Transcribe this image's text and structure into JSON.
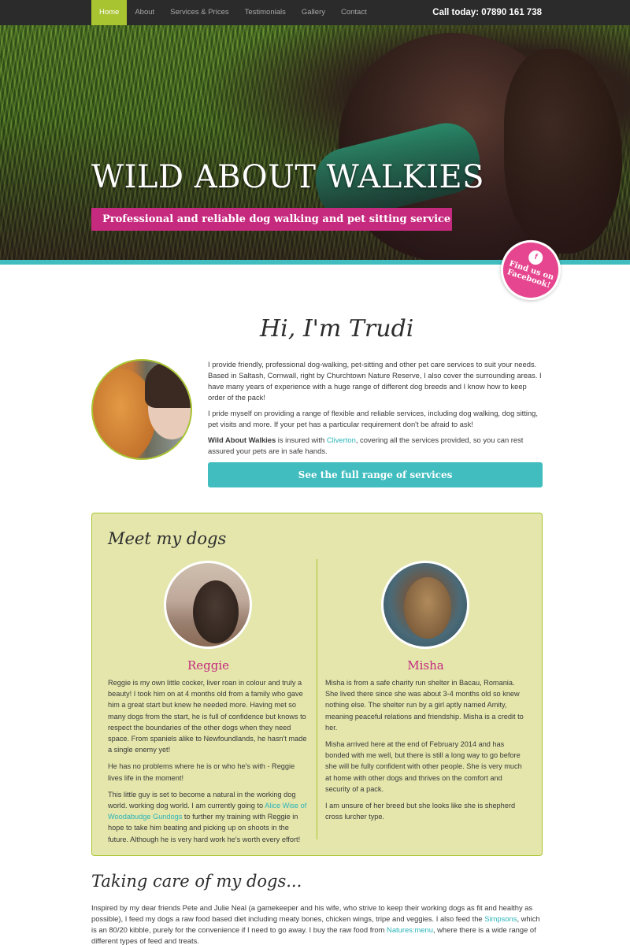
{
  "nav": {
    "items": [
      {
        "label": "Home",
        "active": true
      },
      {
        "label": "About",
        "active": false
      },
      {
        "label": "Services & Prices",
        "active": false
      },
      {
        "label": "Testimonials",
        "active": false
      },
      {
        "label": "Gallery",
        "active": false
      },
      {
        "label": "Contact",
        "active": false
      }
    ],
    "phone": "Call today: 07890 161 738"
  },
  "hero": {
    "title": "WILD ABOUT WALKIES",
    "tagline": "Professional and reliable dog walking and pet sitting service"
  },
  "facebook_badge": {
    "icon": "paw-icon",
    "line1": "Find us on",
    "line2": "Facebook!"
  },
  "intro": {
    "heading": "Hi, I'm Trudi",
    "p1": "I provide friendly, professional dog-walking, pet-sitting and other pet care services to suit your needs. Based in Saltash, Cornwall, right by Churchtown Nature Reserve, I also cover the surrounding areas. I have many years of experience with a huge range of different dog breeds and I know how to keep order of the pack!",
    "p2": "I pride myself on providing a range of flexible and reliable services, including dog walking, dog sitting, pet visits and more. If your pet has a particular requirement don't be afraid to ask!",
    "p3_strong": "Wild About Walkies",
    "p3_pre": " is insured with ",
    "p3_link": "Cliverton",
    "p3_post": ", covering all the services provided, so you can rest assured your pets are in safe hands.",
    "button": "See the full range of services"
  },
  "dogs": {
    "heading": "Meet my dogs",
    "reggie": {
      "name": "Reggie",
      "p1": "Reggie is my own little cocker, liver roan in colour and truly a beauty! I took him on at 4 months old from a family who gave him a great start but knew he needed more. Having met so many dogs from the start, he is full of confidence but knows to respect the boundaries of the other dogs when they need space. From spaniels alike to Newfoundlands, he hasn't made a single enemy yet!",
      "p2": "He has no problems where he is or who he's with - Reggie lives life in the moment!",
      "p3_pre": "This little guy is set to become a natural in the working dog world. working dog world. I am currently going to ",
      "p3_link": "Alice Wise of Woodabudge Gundogs",
      "p3_post": " to further my training with Reggie in hope to take him beating and picking up on shoots in the future. Although he is very hard work he's worth every effort!"
    },
    "misha": {
      "name": "Misha",
      "p1": "Misha is from a safe charity run shelter in Bacau, Romania. She lived there since she was about 3-4 months old so knew nothing else. The shelter run by a girl aptly named Amity, meaning peaceful relations and friendship. Misha is a credit to her.",
      "p2": "Misha arrived here at the end of February 2014 and has bonded with me well, but there is still a long way to go before she will be fully confident with other people. She is very much at home with other dogs and thrives on the comfort and security of a pack.",
      "p3": "I am unsure of her breed but she looks like she is shepherd cross lurcher type."
    }
  },
  "care": {
    "heading": "Taking care of my dogs...",
    "p_pre": "Inspired by my dear friends Pete and Julie Neal (a gamekeeper and his wife, who strive to keep their working dogs as fit and healthy as possible), I feed my dogs a raw food based diet including meaty bones, chicken wings, tripe and veggies. I also feed the ",
    "link1": "Simpsons",
    "p_mid": ", which is an 80/20 kibble, purely for the convenience if I need to go away. I buy the raw food from ",
    "link2": "Natures:menu",
    "p_post": ", where there is a wide range of different types of feed and treats."
  },
  "colors": {
    "nav_bg": "#2b2b2b",
    "nav_active": "#a9c431",
    "accent_teal": "#41bdbf",
    "accent_pink": "#c52a7e",
    "badge_pink": "#e6468f",
    "panel_bg": "#e4e6ac"
  }
}
